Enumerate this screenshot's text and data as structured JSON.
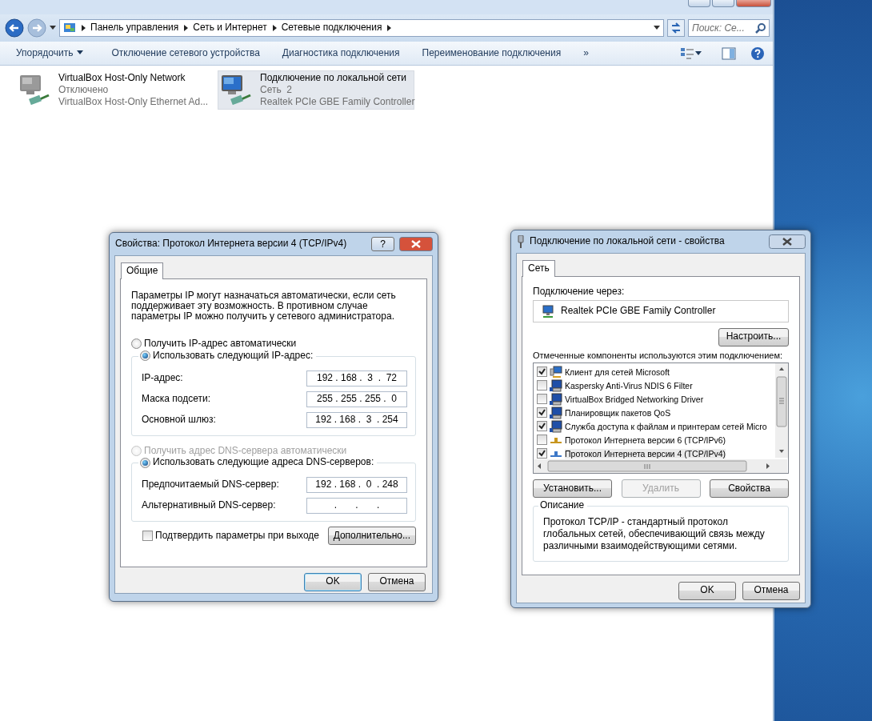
{
  "explorer": {
    "address_path": [
      "Панель управления",
      "Сеть и Интернет",
      "Сетевые подключения"
    ],
    "search": {
      "placeholder": "Поиск: Се..."
    },
    "toolbar": [
      {
        "label": "Упорядочить",
        "kind": "menu"
      },
      {
        "label": "Отключение сетевого устройства",
        "kind": "plain"
      },
      {
        "label": "Диагностика подключения",
        "kind": "plain"
      },
      {
        "label": "Переименование подключения",
        "kind": "plain"
      },
      {
        "label": "»",
        "kind": "overflow"
      }
    ],
    "connections": [
      {
        "name": "VirtualBox Host-Only Network",
        "status": "Отключено",
        "adapter": "VirtualBox Host-Only Ethernet Ad...",
        "selected": false,
        "disabled": true
      },
      {
        "name": "Подключение по локальной сети",
        "status": "Сеть  2",
        "adapter": "Realtek PCIe GBE Family Controller",
        "selected": true,
        "disabled": false
      }
    ]
  },
  "ipv4_dialog": {
    "title": "Свойства: Протокол Интернета версии 4 (TCP/IPv4)",
    "help_button": "?",
    "tabs": [
      {
        "label": "Общие",
        "selected": true
      }
    ],
    "intro": "Параметры IP могут назначаться автоматически, если сеть поддерживает эту возможность. В противном случае параметры IP можно получить у сетевого администратора.",
    "ip_mode": [
      {
        "label": "Получить IP-адрес автоматически",
        "selected": false,
        "disabled": false
      },
      {
        "label": "Использовать следующий IP-адрес:",
        "selected": true,
        "disabled": false
      }
    ],
    "ip_fields": [
      {
        "label": "IP-адрес:",
        "value": "192 . 168 .  3  .  72"
      },
      {
        "label": "Маска подсети:",
        "value": "255 . 255 . 255 .  0"
      },
      {
        "label": "Основной шлюз:",
        "value": "192 . 168 .  3  . 254"
      }
    ],
    "dns_mode": [
      {
        "label": "Получить адрес DNS-сервера автоматически",
        "selected": false,
        "disabled": true
      },
      {
        "label": "Использовать следующие адреса DNS-серверов:",
        "selected": true,
        "disabled": false
      }
    ],
    "dns_fields": [
      {
        "label": "Предпочитаемый DNS-сервер:",
        "value": "192 . 168 .  0  . 248"
      },
      {
        "label": "Альтернативный DNS-сервер:",
        "value": ".       .       ."
      }
    ],
    "confirm": {
      "label": "Подтвердить параметры при выходе",
      "checked": false
    },
    "advanced_button": "Дополнительно...",
    "buttons": [
      {
        "label": "OK",
        "default": true
      },
      {
        "label": "Отмена",
        "default": false
      }
    ]
  },
  "lan_dialog": {
    "title": "Подключение по локальной сети - свойства",
    "tabs": [
      {
        "label": "Сеть",
        "selected": true
      }
    ],
    "connect_via_label": "Подключение через:",
    "adapter": "Realtek PCIe GBE Family Controller",
    "configure_button": "Настроить...",
    "components_label": "Отмеченные компоненты используются этим подключением:",
    "components": [
      {
        "label": "Клиент для сетей Microsoft",
        "checked": true,
        "selected": false,
        "kind": "client"
      },
      {
        "label": "Kaspersky Anti-Virus NDIS 6 Filter",
        "checked": false,
        "selected": false,
        "kind": "service"
      },
      {
        "label": "VirtualBox Bridged Networking Driver",
        "checked": false,
        "selected": false,
        "kind": "service"
      },
      {
        "label": "Планировщик пакетов QoS",
        "checked": true,
        "selected": false,
        "kind": "service"
      },
      {
        "label": "Служба доступа к файлам и принтерам сетей Micro",
        "checked": true,
        "selected": false,
        "kind": "service"
      },
      {
        "label": "Протокол Интернета версии 6 (TCP/IPv6)",
        "checked": false,
        "selected": false,
        "kind": "protocol",
        "color": "#c8961e"
      },
      {
        "label": "Протокол Интернета версии 4 (TCP/IPv4)",
        "checked": true,
        "selected": true,
        "kind": "protocol",
        "color": "#3c78c8"
      }
    ],
    "actions": [
      {
        "label": "Установить...",
        "disabled": false
      },
      {
        "label": "Удалить",
        "disabled": true
      },
      {
        "label": "Свойства",
        "disabled": false
      }
    ],
    "description_title": "Описание",
    "description": "Протокол TCP/IP - стандартный протокол глобальных сетей, обеспечивающий связь между различными взаимодействующими сетями.",
    "buttons": [
      {
        "label": "OK",
        "default": false
      },
      {
        "label": "Отмена",
        "default": false
      }
    ]
  }
}
